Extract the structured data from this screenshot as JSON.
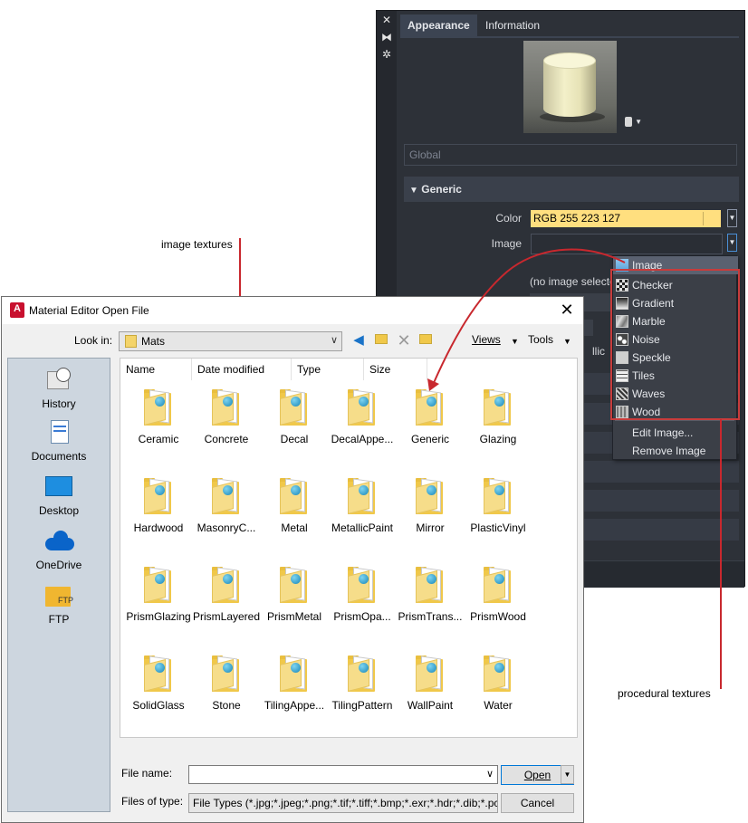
{
  "annotations": {
    "image_textures": "image textures",
    "procedural_textures": "procedural textures"
  },
  "material_editor": {
    "tabs": [
      "Appearance",
      "Information"
    ],
    "global_placeholder": "Global",
    "section_title": "Generic",
    "color_label": "Color",
    "color_value": "RGB 255 223 127",
    "color_hex": "#ffdf7f",
    "image_label": "Image",
    "no_image_text": "(no image selecte",
    "partial_text": "llic",
    "preview_shape_icon": "cylinder-icon"
  },
  "texture_menu": {
    "items": [
      {
        "label": "Image",
        "icon": "image-icon"
      },
      {
        "label": "Checker",
        "icon": "checker-icon"
      },
      {
        "label": "Gradient",
        "icon": "gradient-icon"
      },
      {
        "label": "Marble",
        "icon": "marble-icon"
      },
      {
        "label": "Noise",
        "icon": "noise-icon"
      },
      {
        "label": "Speckle",
        "icon": "speckle-icon"
      },
      {
        "label": "Tiles",
        "icon": "tiles-icon"
      },
      {
        "label": "Waves",
        "icon": "waves-icon"
      },
      {
        "label": "Wood",
        "icon": "wood-icon"
      }
    ],
    "edit_image": "Edit Image...",
    "remove_image": "Remove Image"
  },
  "dialog": {
    "title": "Material Editor Open File",
    "look_in_label": "Look in:",
    "look_in_value": "Mats",
    "views_label": "Views",
    "tools_label": "Tools",
    "places": [
      "History",
      "Documents",
      "Desktop",
      "OneDrive",
      "FTP"
    ],
    "columns": [
      "Name",
      "Date modified",
      "Type",
      "Size"
    ],
    "files": [
      "Ceramic",
      "Concrete",
      "Decal",
      "DecalAppe...",
      "Generic",
      "Glazing",
      "Hardwood",
      "MasonryC...",
      "Metal",
      "MetallicPaint",
      "Mirror",
      "PlasticVinyl",
      "PrismGlazing",
      "PrismLayered",
      "PrismMetal",
      "PrismOpa...",
      "PrismTrans...",
      "PrismWood",
      "SolidGlass",
      "Stone",
      "TilingAppe...",
      "TilingPattern",
      "WallPaint",
      "Water"
    ],
    "file_name_label": "File name:",
    "file_name_value": "",
    "files_of_type_label": "Files of type:",
    "files_of_type_value": "File Types (*.jpg;*.jpeg;*.png;*.tif;*.tiff;*.bmp;*.exr;*.hdr;*.dib;*.pcx;*.g",
    "open_label": "Open",
    "cancel_label": "Cancel"
  }
}
